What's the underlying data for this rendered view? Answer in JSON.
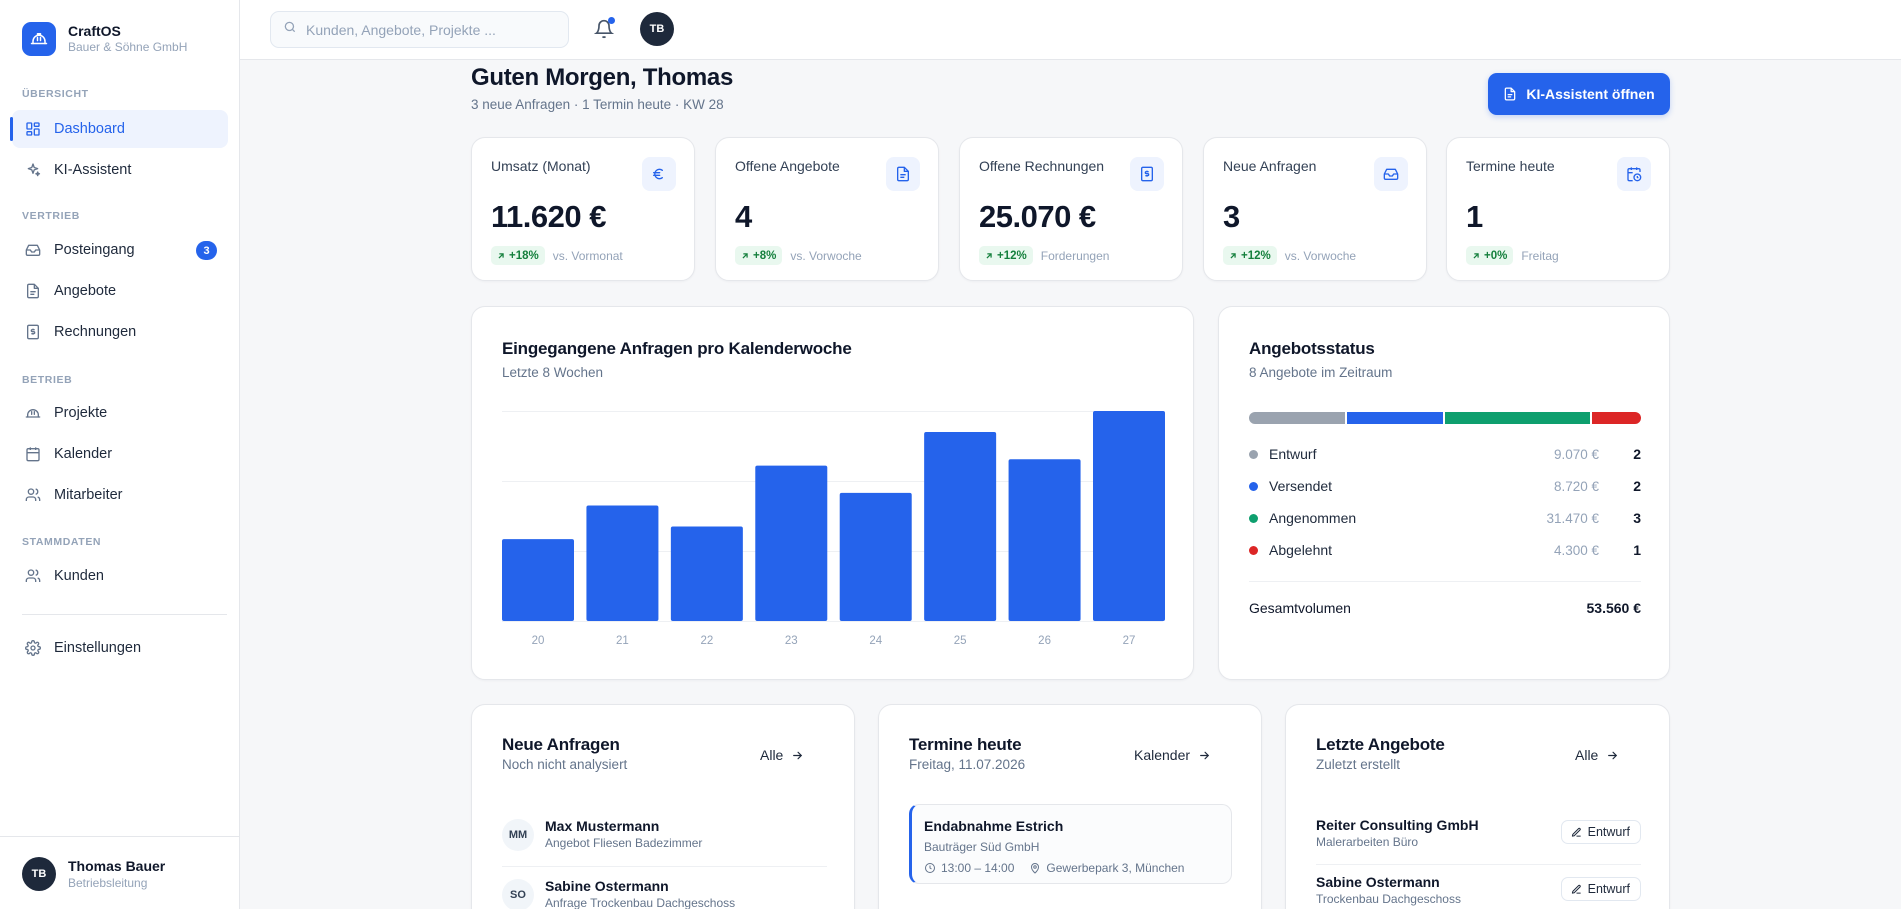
{
  "sidebar": {
    "brand": {
      "name": "CraftOS",
      "company": "Bauer & Söhne GmbH",
      "logo_icon": "hard-hat-icon"
    },
    "sections": {
      "overview": "ÜBERSICHT",
      "sales": "VERTRIEB",
      "operations": "BETRIEB",
      "master_data": "STAMMDATEN"
    },
    "items": [
      {
        "label": "Dashboard",
        "icon": "layout-grid-icon",
        "active": true
      },
      {
        "label": "KI-Assistent",
        "icon": "sparkles-icon"
      },
      {
        "label": "Posteingang",
        "icon": "inbox-icon",
        "badge": "3"
      },
      {
        "label": "Angebote",
        "icon": "document-icon"
      },
      {
        "label": "Rechnungen",
        "icon": "invoice-icon"
      },
      {
        "label": "Projekte",
        "icon": "hard-hat-icon"
      },
      {
        "label": "Kalender",
        "icon": "calendar-icon"
      },
      {
        "label": "Mitarbeiter",
        "icon": "users-icon"
      },
      {
        "label": "Kunden",
        "icon": "users-icon"
      },
      {
        "label": "Einstellungen",
        "icon": "gear-icon"
      }
    ],
    "user": {
      "initials": "TB",
      "name": "Thomas Bauer",
      "role": "Betriebsleitung"
    }
  },
  "topbar": {
    "search_placeholder": "Kunden, Angebote, Projekte ...",
    "avatar_initials": "TB"
  },
  "header": {
    "greeting": "Guten Morgen, Thomas",
    "subtitle": "3 neue Anfragen · 1 Termin heute · KW 28",
    "ki_button": "KI-Assistent öffnen"
  },
  "kpis": [
    {
      "label": "Umsatz (Monat)",
      "value": "11.620 €",
      "delta": "+18%",
      "note": "vs. Vormonat",
      "icon": "euro-icon"
    },
    {
      "label": "Offene Angebote",
      "value": "4",
      "delta": "+8%",
      "note": "vs. Vorwoche",
      "icon": "document-icon"
    },
    {
      "label": "Offene Rechnungen",
      "value": "25.070 €",
      "delta": "+12%",
      "note": "Forderungen",
      "icon": "invoice-icon"
    },
    {
      "label": "Neue Anfragen",
      "value": "3",
      "delta": "+12%",
      "note": "vs. Vorwoche",
      "icon": "inbox-icon"
    },
    {
      "label": "Termine heute",
      "value": "1",
      "delta": "+0%",
      "note": "Freitag",
      "icon": "calendar-clock-icon"
    }
  ],
  "chart_data": {
    "type": "bar",
    "title": "Eingegangene Anfragen pro Kalenderwoche",
    "subtitle": "Letzte 8 Wochen",
    "categories": [
      "20",
      "21",
      "22",
      "23",
      "24",
      "25",
      "26",
      "27"
    ],
    "values": [
      3.9,
      5.5,
      4.5,
      7.4,
      6.1,
      9.0,
      7.7,
      10.0
    ],
    "ylim": [
      0,
      10
    ],
    "color": "#2563eb",
    "grid": true
  },
  "offer_status": {
    "title": "Angebotsstatus",
    "subtitle": "8 Angebote im Zeitraum",
    "rows": [
      {
        "label": "Entwurf",
        "amount": "9.070 €",
        "count": "2",
        "color": "#9aa3af",
        "share": 0.25
      },
      {
        "label": "Versendet",
        "amount": "8.720 €",
        "count": "2",
        "color": "#2563eb",
        "share": 0.25
      },
      {
        "label": "Angenommen",
        "amount": "31.470 €",
        "count": "3",
        "color": "#0e9f6e",
        "share": 0.375
      },
      {
        "label": "Abgelehnt",
        "amount": "4.300 €",
        "count": "1",
        "color": "#dc2626",
        "share": 0.125
      }
    ],
    "total_label": "Gesamtvolumen",
    "total_value": "53.560 €"
  },
  "new_requests": {
    "title": "Neue Anfragen",
    "subtitle": "Noch nicht analysiert",
    "link": "Alle",
    "items": [
      {
        "initials": "MM",
        "name": "Max Mustermann",
        "desc": "Angebot Fliesen Badezimmer"
      },
      {
        "initials": "SO",
        "name": "Sabine Ostermann",
        "desc": "Anfrage Trockenbau Dachgeschoss"
      }
    ]
  },
  "appointments": {
    "title": "Termine heute",
    "subtitle": "Freitag, 11.07.2026",
    "link": "Kalender",
    "items": [
      {
        "title": "Endabnahme Estrich",
        "client": "Bauträger Süd GmbH",
        "time": "13:00 – 14:00",
        "location": "Gewerbepark 3, München"
      }
    ]
  },
  "recent_offers": {
    "title": "Letzte Angebote",
    "subtitle": "Zuletzt erstellt",
    "link": "Alle",
    "items": [
      {
        "name": "Reiter Consulting GmbH",
        "desc": "Malerarbeiten Büro",
        "status": "Entwurf"
      },
      {
        "name": "Sabine Ostermann",
        "desc": "Trockenbau Dachgeschoss",
        "status": "Entwurf"
      }
    ]
  }
}
